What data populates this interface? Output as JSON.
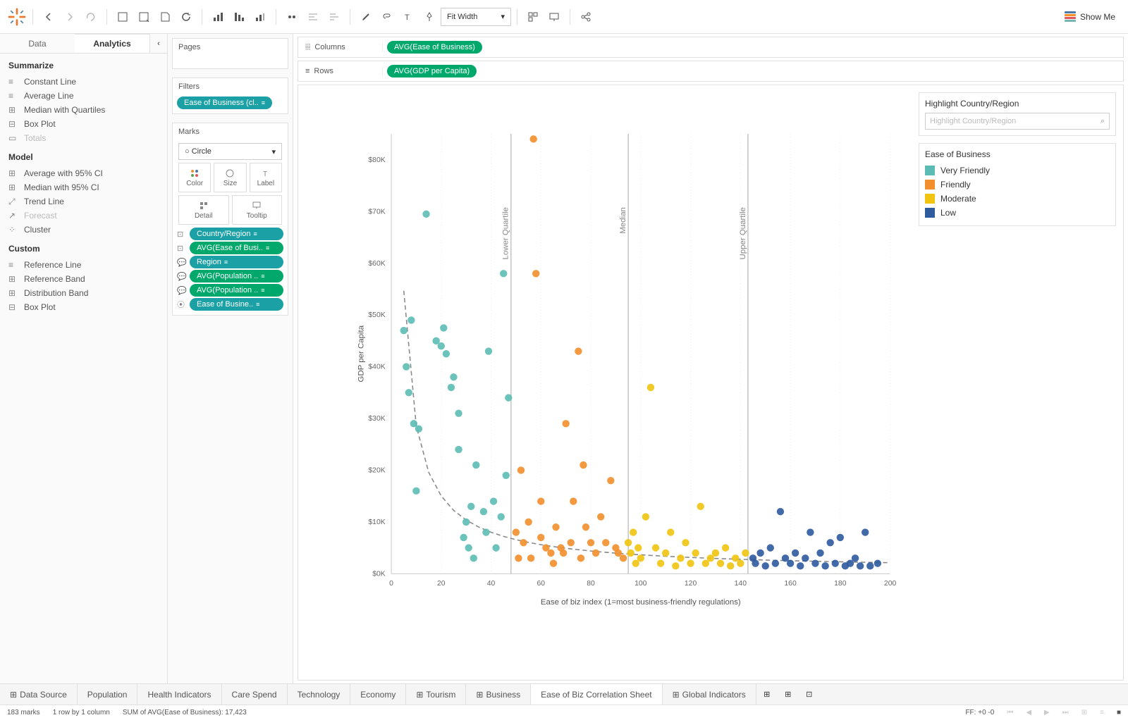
{
  "toolbar": {
    "fit_select": "Fit Width",
    "showme_label": "Show Me"
  },
  "left_pane": {
    "tabs": [
      "Data",
      "Analytics"
    ],
    "active_tab": 1,
    "sections": {
      "summarize": {
        "title": "Summarize",
        "items": [
          "Constant Line",
          "Average Line",
          "Median with Quartiles",
          "Box Plot",
          "Totals"
        ]
      },
      "model": {
        "title": "Model",
        "items": [
          "Average with 95% CI",
          "Median with 95% CI",
          "Trend Line",
          "Forecast",
          "Cluster"
        ]
      },
      "custom": {
        "title": "Custom",
        "items": [
          "Reference Line",
          "Reference Band",
          "Distribution Band",
          "Box Plot"
        ]
      }
    }
  },
  "mid_pane": {
    "pages_title": "Pages",
    "filters_title": "Filters",
    "filter_pill": "Ease of Business (cl..",
    "marks_title": "Marks",
    "marks_type": "Circle",
    "shelf": {
      "color": "Color",
      "size": "Size",
      "label": "Label",
      "detail": "Detail",
      "tooltip": "Tooltip"
    },
    "mark_pills": [
      {
        "label": "Country/Region",
        "color": "teal",
        "icon": "detail"
      },
      {
        "label": "AVG(Ease of Busi..",
        "color": "green",
        "icon": "detail"
      },
      {
        "label": "Region",
        "color": "teal",
        "icon": "tooltip"
      },
      {
        "label": "AVG(Population ..",
        "color": "green",
        "icon": "tooltip"
      },
      {
        "label": "AVG(Population ..",
        "color": "green",
        "icon": "tooltip"
      },
      {
        "label": "Ease of Busine..",
        "color": "teal",
        "icon": "color"
      }
    ]
  },
  "shelves": {
    "columns_label": "Columns",
    "columns_pill": "AVG(Ease of Business)",
    "rows_label": "Rows",
    "rows_pill": "AVG(GDP per Capita)"
  },
  "legend": {
    "highlight_title": "Highlight Country/Region",
    "highlight_placeholder": "Highlight Country/Region",
    "color_title": "Ease of Business",
    "items": [
      {
        "label": "Very Friendly",
        "color": "#5cbcb5"
      },
      {
        "label": "Friendly",
        "color": "#f28e2b"
      },
      {
        "label": "Moderate",
        "color": "#f1c40f"
      },
      {
        "label": "Low",
        "color": "#2e5a9e"
      }
    ]
  },
  "chart_data": {
    "type": "scatter",
    "xlabel": "Ease of biz index (1=most business-friendly regulations)",
    "ylabel": "GDP per Capita",
    "xlim": [
      0,
      200
    ],
    "ylim": [
      0,
      85000
    ],
    "xticks": [
      0,
      20,
      40,
      60,
      80,
      100,
      120,
      140,
      160,
      180,
      200
    ],
    "yticks": [
      0,
      10000,
      20000,
      30000,
      40000,
      50000,
      60000,
      70000,
      80000
    ],
    "ytick_labels": [
      "$0K",
      "$10K",
      "$20K",
      "$30K",
      "$40K",
      "$50K",
      "$60K",
      "$70K",
      "$80K"
    ],
    "reference_lines": [
      {
        "label": "Lower Quartile",
        "x": 48
      },
      {
        "label": "Median",
        "x": 95
      },
      {
        "label": "Upper Quartile",
        "x": 143
      }
    ],
    "trend": {
      "type": "power-decay",
      "path": "inverse-like curve from high y at low x tapering toward x≈200"
    },
    "series": [
      {
        "name": "Very Friendly",
        "color": "#5cbcb5",
        "points": [
          [
            5,
            47000
          ],
          [
            6,
            40000
          ],
          [
            7,
            35000
          ],
          [
            8,
            49000
          ],
          [
            9,
            29000
          ],
          [
            10,
            16000
          ],
          [
            11,
            28000
          ],
          [
            14,
            69500
          ],
          [
            18,
            45000
          ],
          [
            20,
            44000
          ],
          [
            21,
            47500
          ],
          [
            22,
            42500
          ],
          [
            24,
            36000
          ],
          [
            25,
            38000
          ],
          [
            27,
            24000
          ],
          [
            27,
            31000
          ],
          [
            29,
            7000
          ],
          [
            30,
            10000
          ],
          [
            31,
            5000
          ],
          [
            32,
            13000
          ],
          [
            33,
            3000
          ],
          [
            34,
            21000
          ],
          [
            37,
            12000
          ],
          [
            38,
            8000
          ],
          [
            39,
            43000
          ],
          [
            41,
            14000
          ],
          [
            42,
            5000
          ],
          [
            44,
            11000
          ],
          [
            45,
            58000
          ],
          [
            46,
            19000
          ],
          [
            47,
            34000
          ]
        ]
      },
      {
        "name": "Friendly",
        "color": "#f28e2b",
        "points": [
          [
            50,
            8000
          ],
          [
            51,
            3000
          ],
          [
            52,
            20000
          ],
          [
            53,
            6000
          ],
          [
            55,
            10000
          ],
          [
            56,
            3000
          ],
          [
            57,
            84000
          ],
          [
            58,
            58000
          ],
          [
            60,
            7000
          ],
          [
            60,
            14000
          ],
          [
            62,
            5000
          ],
          [
            64,
            4000
          ],
          [
            65,
            2000
          ],
          [
            66,
            9000
          ],
          [
            68,
            5000
          ],
          [
            69,
            4000
          ],
          [
            70,
            29000
          ],
          [
            72,
            6000
          ],
          [
            73,
            14000
          ],
          [
            75,
            43000
          ],
          [
            76,
            3000
          ],
          [
            77,
            21000
          ],
          [
            78,
            9000
          ],
          [
            80,
            6000
          ],
          [
            82,
            4000
          ],
          [
            84,
            11000
          ],
          [
            86,
            6000
          ],
          [
            88,
            18000
          ],
          [
            90,
            5000
          ],
          [
            91,
            4000
          ],
          [
            93,
            3000
          ]
        ]
      },
      {
        "name": "Moderate",
        "color": "#f1c40f",
        "points": [
          [
            95,
            6000
          ],
          [
            96,
            4000
          ],
          [
            97,
            8000
          ],
          [
            98,
            2000
          ],
          [
            99,
            5000
          ],
          [
            100,
            3000
          ],
          [
            102,
            11000
          ],
          [
            104,
            36000
          ],
          [
            106,
            5000
          ],
          [
            108,
            2000
          ],
          [
            110,
            4000
          ],
          [
            112,
            8000
          ],
          [
            114,
            1500
          ],
          [
            116,
            3000
          ],
          [
            118,
            6000
          ],
          [
            120,
            2000
          ],
          [
            122,
            4000
          ],
          [
            124,
            13000
          ],
          [
            126,
            2000
          ],
          [
            128,
            3000
          ],
          [
            130,
            4000
          ],
          [
            132,
            2000
          ],
          [
            134,
            5000
          ],
          [
            136,
            1500
          ],
          [
            138,
            3000
          ],
          [
            140,
            2000
          ],
          [
            142,
            4000
          ]
        ]
      },
      {
        "name": "Low",
        "color": "#2e5a9e",
        "points": [
          [
            145,
            3000
          ],
          [
            146,
            2000
          ],
          [
            148,
            4000
          ],
          [
            150,
            1500
          ],
          [
            152,
            5000
          ],
          [
            154,
            2000
          ],
          [
            156,
            12000
          ],
          [
            158,
            3000
          ],
          [
            160,
            2000
          ],
          [
            162,
            4000
          ],
          [
            164,
            1500
          ],
          [
            166,
            3000
          ],
          [
            168,
            8000
          ],
          [
            170,
            2000
          ],
          [
            172,
            4000
          ],
          [
            174,
            1500
          ],
          [
            176,
            6000
          ],
          [
            178,
            2000
          ],
          [
            180,
            7000
          ],
          [
            182,
            1500
          ],
          [
            184,
            2000
          ],
          [
            186,
            3000
          ],
          [
            188,
            1500
          ],
          [
            190,
            8000
          ],
          [
            192,
            1500
          ],
          [
            195,
            2000
          ]
        ]
      }
    ]
  },
  "bottom_tabs": {
    "datasource": "Data Source",
    "tabs": [
      "Population",
      "Health Indicators",
      "Care Spend",
      "Technology",
      "Economy",
      "Tourism",
      "Business",
      "Ease of Biz Correlation Sheet",
      "Global Indicators"
    ],
    "active": 7
  },
  "status": {
    "marks": "183 marks",
    "rows": "1 row by 1 column",
    "sum": "SUM of AVG(Ease of Business): 17,423",
    "ff": "FF: +0 -0"
  }
}
